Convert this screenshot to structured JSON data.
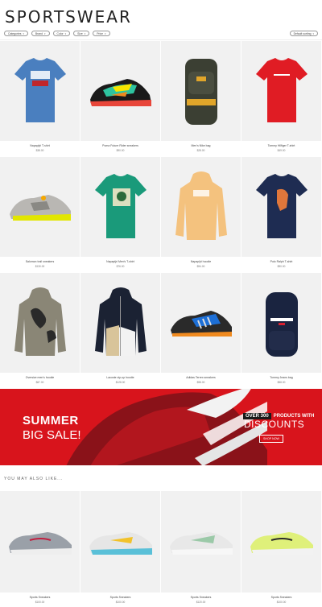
{
  "page": {
    "title": "SPORTSWEAR"
  },
  "filters": [
    {
      "label": "Categories"
    },
    {
      "label": "Brand"
    },
    {
      "label": "Color"
    },
    {
      "label": "Size"
    },
    {
      "label": "Price"
    }
  ],
  "sort": {
    "label": "Default sorting"
  },
  "products": [
    {
      "name": "Napapijri T-shirt",
      "price": "$38.00"
    },
    {
      "name": "Puma Future Rider sneakers",
      "price": "$90.00"
    },
    {
      "name": "Men's Nike bag",
      "price": "$28.00"
    },
    {
      "name": "Tommy Hilfiger T-shirt",
      "price": "$49.00"
    },
    {
      "name": "Salomon trail sneakers",
      "price": "$130.00"
    },
    {
      "name": "Napapijri Men's T-shirt",
      "price": "$76.00"
    },
    {
      "name": "Napapijri hoodie",
      "price": "$94.00"
    },
    {
      "name": "Polo Ralph T-shirt",
      "price": "$90.00"
    },
    {
      "name": "Oversize men's hoodie",
      "price": "$87.00"
    },
    {
      "name": "Lacoste zip-up hoodie",
      "price": "$128.00"
    },
    {
      "name": "Adidas Terrex sneakers",
      "price": "$98.00"
    },
    {
      "name": "Tommy Jeans bag",
      "price": "$58.00"
    }
  ],
  "banner": {
    "summer": "SUMMER",
    "sale": "BIG SALE!",
    "over": "OVER 300",
    "products_with": "PRODUCTS WITH",
    "discounts": "DISCOUNTS",
    "shop": "SHOP NOW"
  },
  "also": {
    "heading": "YOU MAY ALSO LIKE..."
  },
  "recommended": [
    {
      "name": "Sports Sneakers",
      "price": "$100.00"
    },
    {
      "name": "Sports Sneakers",
      "price": "$100.00"
    },
    {
      "name": "Sports Sneakers",
      "price": "$120.00"
    },
    {
      "name": "Sports Sneakers",
      "price": "$100.00"
    }
  ]
}
